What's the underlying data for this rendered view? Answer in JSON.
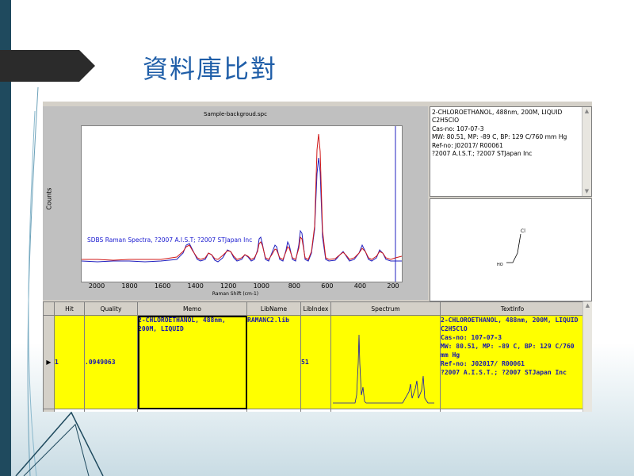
{
  "slide": {
    "title": "資料庫比對"
  },
  "plot": {
    "title": "Sample-backgroud.spc",
    "ylabel": "Counts",
    "xlabel": "Raman Shift (cm-1)",
    "annotation": "SDBS Raman Spectra, ?2007 A.I.S.T; ?2007 STJapan Inc",
    "xticks": [
      "2000",
      "1800",
      "1600",
      "1400",
      "1200",
      "1000",
      "800",
      "600",
      "400",
      "200"
    ]
  },
  "info": {
    "lines": "2-CHLOROETHANOL, 488nm, 200M, LIQUID\nC2H5ClO\nCas-no: 107-07-3\nMW: 80.51, MP: -89 C, BP: 129 C/760 mm Hg\nRef-no: J02017/ R00061\n?2007 A.I.S.T.; ?2007 STJapan Inc"
  },
  "structure": {
    "cl_label": "Cl",
    "ho_label": "HO"
  },
  "grid": {
    "headers": [
      "Hit",
      "Quality",
      "Memo",
      "LibName",
      "LibIndex",
      "Spectrum",
      "TextInfo"
    ],
    "row": {
      "hit": "1",
      "quality": ".0949063",
      "memo": "2-CHLOROETHANOL, 488nm, 200M, LIQUID",
      "libname": "RAMANC2.lib",
      "libindex": "51",
      "textinfo": "2-CHLOROETHANOL, 488nm, 200M, LIQUID\nC2H5ClO\nCas-no: 107-07-3\nMW: 80.51, MP: -89 C, BP: 129 C/760 mm Hg\nRef-no: J02017/ R00061\n?2007 A.I.S.T.; ?2007 STJapan Inc"
    }
  },
  "colors": {
    "sample": "#d01818",
    "library": "#2020c0",
    "highlight": "#ffff00"
  }
}
